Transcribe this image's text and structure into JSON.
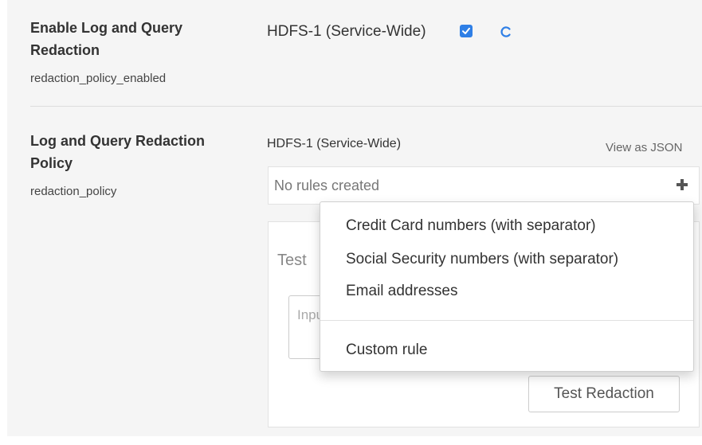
{
  "settings": [
    {
      "name_line1": "Enable Log and Query",
      "name_line2": "Redaction",
      "key": "redaction_policy_enabled",
      "scope": "HDFS-1 (Service-Wide)",
      "checked": true
    },
    {
      "name_line1": "Log and Query Redaction",
      "name_line2": "Policy",
      "key": "redaction_policy",
      "scope": "HDFS-1 (Service-Wide)",
      "view_json_label": "View as JSON",
      "rules_empty_text": "No rules created",
      "test_title": "Test",
      "test_input_placeholder": "Input",
      "test_button_label": "Test Redaction"
    }
  ],
  "rule_menu": {
    "items": [
      "Credit Card numbers (with separator)",
      "Social Security numbers (with separator)",
      "Email addresses"
    ],
    "custom_item": "Custom rule"
  },
  "colors": {
    "checkbox": "#2f7fe6",
    "refresh_icon": "#2f7fe6",
    "panel_background": "#f5f5f5"
  },
  "icons": {
    "checkbox": "checkbox-checked-icon",
    "refresh": "refresh-icon",
    "add": "plus-icon"
  }
}
